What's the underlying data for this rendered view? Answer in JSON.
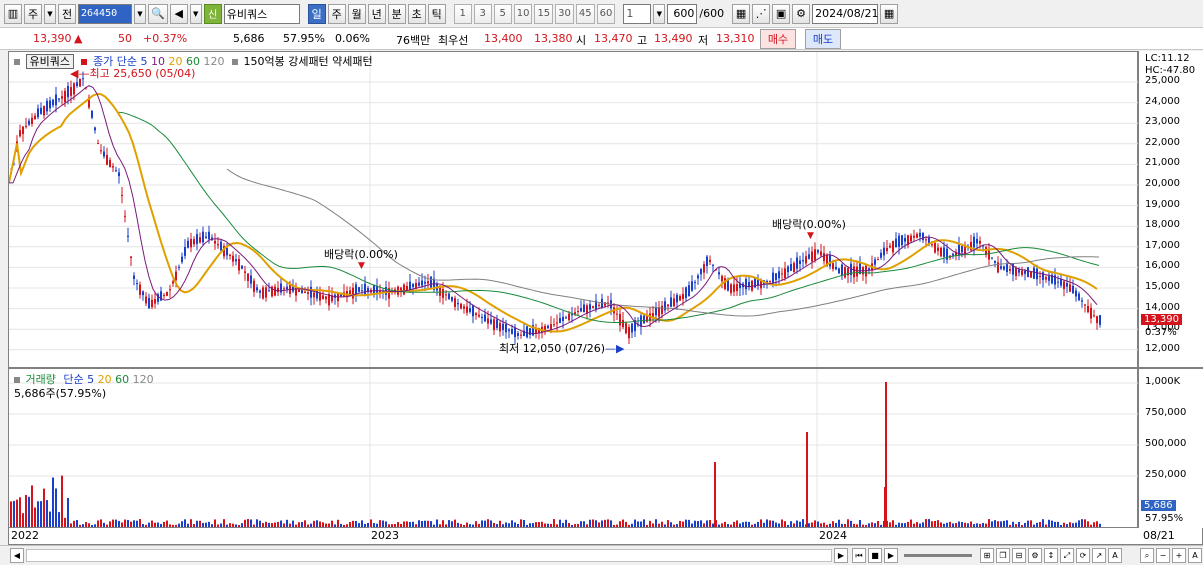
{
  "toolbar": {
    "type_label": "주",
    "prev_label": "전",
    "code": "264450",
    "shin_label": "신",
    "stock_name": "유비쿼스",
    "periods": [
      "일",
      "주",
      "월",
      "년",
      "분",
      "초",
      "틱"
    ],
    "active_period": "일",
    "intervals": [
      "1",
      "3",
      "5",
      "10",
      "15",
      "30",
      "45",
      "60"
    ],
    "multiplier": "1",
    "count": "600",
    "count_total": "/600",
    "date": "2024/08/21"
  },
  "quote": {
    "price": "13,390",
    "arrow": "▲",
    "change": "50",
    "change_pct": "+0.37%",
    "volume": "5,686",
    "vol_ratio": "57.95%",
    "turnover": "0.06%",
    "trade_amount": "76백만",
    "best_ask_label": "최우선",
    "best_ask": "13,400",
    "best_bid": "13,380",
    "open_label": "시",
    "open": "13,470",
    "high_label": "고",
    "high": "13,490",
    "low_label": "저",
    "low": "13,310",
    "buy_label": "매수",
    "sell_label": "매도"
  },
  "price_panel": {
    "stock_tab": "유비쿼스",
    "ma_title": "종가 단순",
    "ma_periods": [
      "5",
      "10",
      "20",
      "60",
      "120"
    ],
    "extra": "150억봉 강세패턴  약세패턴",
    "lc": "LC:11.12",
    "hc": "HC:-47.80",
    "high_note": "최고 25,650 (05/04)",
    "low_note": "최저 12,050 (07/26)",
    "dividend_note": "배당락(0.00%)",
    "last_price": "13,390",
    "last_pct": "0.37%",
    "y_ticks": [
      "25,000",
      "24,000",
      "23,000",
      "22,000",
      "21,000",
      "20,000",
      "19,000",
      "18,000",
      "17,000",
      "16,000",
      "15,000",
      "14,000",
      "13,000",
      "12,000"
    ]
  },
  "volume_panel": {
    "title": "거래량",
    "ma_title": "단순",
    "ma_periods": [
      "5",
      "20",
      "60",
      "120"
    ],
    "current": "5,686주(57.95%)",
    "y_ticks": [
      "1,000K",
      "750,000",
      "500,000",
      "250,000"
    ],
    "last_vol": "5,686",
    "last_pct": "57.95%"
  },
  "x_axis": [
    "2022",
    "2023",
    "2024",
    "08/21"
  ],
  "colors": {
    "up": "#d4141c",
    "down": "#1a3fc9",
    "ma5": "#2a2a8c",
    "ma10": "#7a1a7a",
    "ma20": "#e0a000",
    "ma60": "#1a8a3a",
    "ma120": "#808080"
  }
}
